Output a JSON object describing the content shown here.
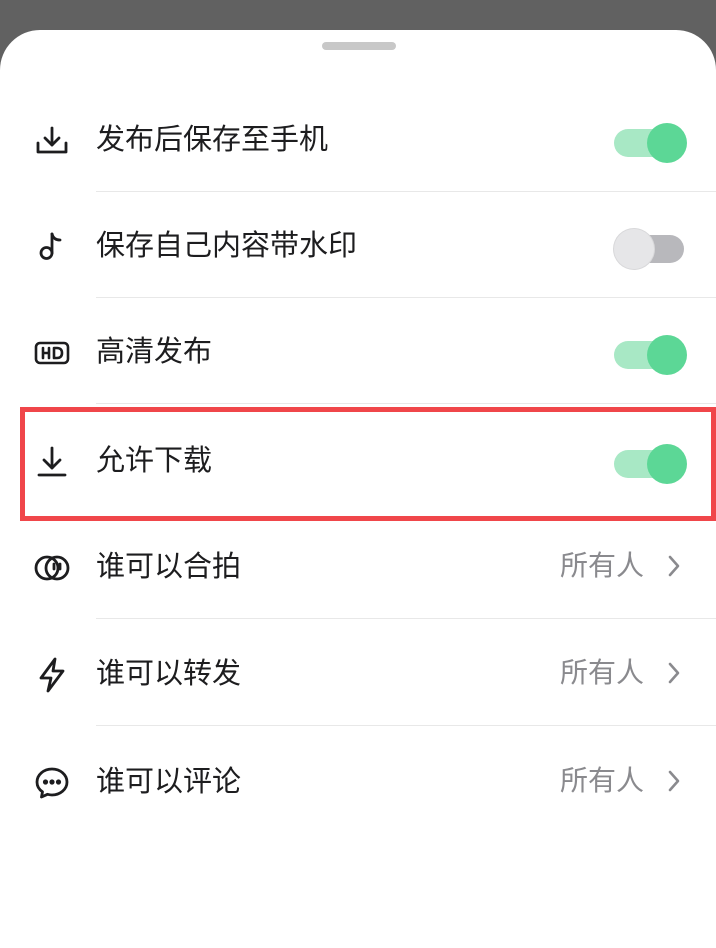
{
  "settings": {
    "rows": [
      {
        "label": "发布后保存至手机",
        "icon": "download-tray-icon",
        "control": "toggle",
        "on": true
      },
      {
        "label": "保存自己内容带水印",
        "icon": "tiktok-note-icon",
        "control": "toggle",
        "on": false
      },
      {
        "label": "高清发布",
        "icon": "hd-icon",
        "control": "toggle",
        "on": true
      },
      {
        "label": "允许下载",
        "icon": "download-arrow-icon",
        "control": "toggle",
        "on": true
      },
      {
        "label": "谁可以合拍",
        "icon": "duet-icon",
        "control": "select",
        "value": "所有人"
      },
      {
        "label": "谁可以转发",
        "icon": "lightning-icon",
        "control": "select",
        "value": "所有人"
      },
      {
        "label": "谁可以评论",
        "icon": "comment-bubble-icon",
        "control": "select",
        "value": "所有人"
      }
    ]
  },
  "colors": {
    "toggle_on_track": "#a8e8c5",
    "toggle_on_knob": "#5cd796",
    "toggle_off_track": "#b8b8bc",
    "toggle_off_knob": "#e6e6e8",
    "highlight": "#f0464a",
    "backdrop": "#616161"
  }
}
